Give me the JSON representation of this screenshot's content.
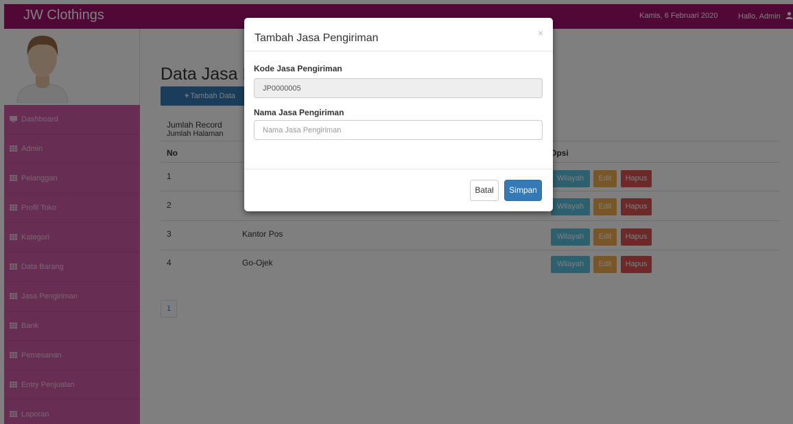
{
  "navbar": {
    "brand": "JW Clothings",
    "date": "Kamis, 6 Februari 2020",
    "greeting": "Hallo, Admin"
  },
  "sidebar": {
    "items": [
      {
        "label": "Dashboard",
        "icon": "monitor-icon"
      },
      {
        "label": "Admin",
        "icon": "table-icon"
      },
      {
        "label": "Pelanggan",
        "icon": "table-icon"
      },
      {
        "label": "Profil Toko",
        "icon": "table-icon"
      },
      {
        "label": "Kategori",
        "icon": "table-icon"
      },
      {
        "label": "Data Barang",
        "icon": "table-icon"
      },
      {
        "label": "Jasa Pengiriman",
        "icon": "table-icon"
      },
      {
        "label": "Bank",
        "icon": "table-icon"
      },
      {
        "label": "Pemesanan",
        "icon": "table-icon"
      },
      {
        "label": "Entry Penjualan",
        "icon": "table-icon"
      },
      {
        "label": "Laporan",
        "icon": "table-icon"
      }
    ]
  },
  "main": {
    "title": "Data Jasa Pe",
    "add_button": "Tambah Data",
    "jumlah_record": "Jumlah Record",
    "jumlah_halaman": "Jumlah Halaman",
    "columns": {
      "no": "No",
      "opsi": "Opsi"
    },
    "rows": [
      {
        "no": "1",
        "name": ""
      },
      {
        "no": "2",
        "name": ""
      },
      {
        "no": "3",
        "name": "Kantor Pos"
      },
      {
        "no": "4",
        "name": "Go-Ojek"
      }
    ],
    "actions": {
      "wilayah": "Wilayah",
      "edit": "Edit",
      "hapus": "Hapus"
    },
    "page": "1"
  },
  "modal": {
    "title": "Tambah Jasa Pengiriman",
    "close": "×",
    "kode_label": "Kode Jasa Pengiriman",
    "kode_value": "JP0000005",
    "nama_label": "Nama Jasa Pengiriman",
    "nama_placeholder": "Nama Jasa Pengiriman",
    "batal": "Batal",
    "simpan": "Simpan"
  },
  "colors": {
    "navbar": "#a2106c",
    "sidebar": "#d05aa5",
    "primary": "#337ab7",
    "info": "#5bc0de",
    "warning": "#f0ad4e",
    "danger": "#d9534f"
  }
}
